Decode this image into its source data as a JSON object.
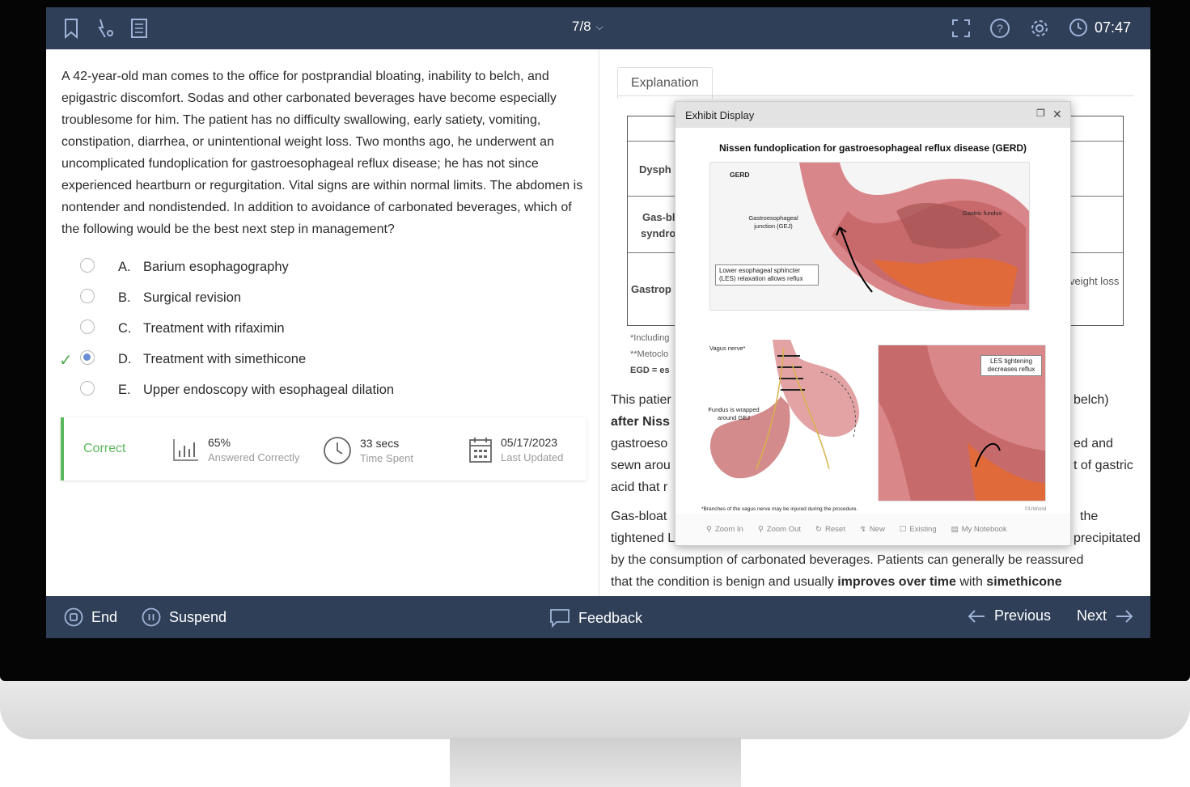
{
  "toolbar": {
    "question_counter": "7/8",
    "timer": "07:47"
  },
  "question": {
    "stem": "A 42-year-old man comes to the office for postprandial bloating, inability to belch, and epigastric discomfort.  Sodas and other carbonated beverages have become especially troublesome for him.  The patient has no difficulty swallowing, early satiety, vomiting, constipation, diarrhea, or unintentional weight loss.  Two months ago, he underwent an uncomplicated fundoplication for gastroesophageal reflux disease; he has not since experienced heartburn or regurgitation.  Vital signs are within normal limits.  The abdomen is nontender and nondistended.  In addition to avoidance of carbonated beverages, which of the following would be the best next step in management?",
    "answers": [
      {
        "letter": "A.",
        "text": "Barium esophagography",
        "selected": false,
        "correct": false
      },
      {
        "letter": "B.",
        "text": "Surgical revision",
        "selected": false,
        "correct": false
      },
      {
        "letter": "C.",
        "text": "Treatment with rifaximin",
        "selected": false,
        "correct": false
      },
      {
        "letter": "D.",
        "text": "Treatment with simethicone",
        "selected": true,
        "correct": true
      },
      {
        "letter": "E.",
        "text": "Upper endoscopy with esophageal dilation",
        "selected": false,
        "correct": false
      }
    ]
  },
  "stats": {
    "status": "Correct",
    "percent": "65%",
    "percent_label": "Answered Correctly",
    "time": "33 secs",
    "time_label": "Time Spent",
    "date": "05/17/2023",
    "date_label": "Last Updated"
  },
  "explanation": {
    "tab_label": "Explanation",
    "table_cells": [
      "Dysph",
      "Gas-bl",
      "syndro",
      "Gastrop",
      "veight loss"
    ],
    "footnotes": [
      "*Including",
      "**Metoclo",
      "EGD = es"
    ],
    "para1_lines": [
      "This patier",
      "after Niss",
      "gastroeso",
      "sewn arou",
      "acid that r"
    ],
    "para1_right": [
      "belch)",
      "ed and",
      "t of gastric"
    ],
    "para2_lines": [
      "Gas-bloat",
      "tightened L",
      "by the consumption of carbonated beverages.  Patients can generally be reassured",
      "that the condition is benign and usually"
    ],
    "para2_right": [
      "the",
      "precipitated"
    ],
    "bold_tail_1": "improves over time",
    "bold_tail_mid": "with",
    "bold_tail_2": "simethicone"
  },
  "exhibit": {
    "window_title": "Exhibit Display",
    "figure_title": "Nissen fundoplication for gastroesophageal reflux disease (GERD)",
    "labels": {
      "gerd": "GERD",
      "gej": "Gastroesophageal junction (GEJ)",
      "fundus": "Gastric fundus",
      "les": "Lower esophageal sphincter (LES) relaxation allows reflux",
      "vagus": "Vagus nerve*",
      "wrapped": "Fundus is wrapped around GEJ",
      "tightening": "LES tightening decreases reflux",
      "footnote": "*Branches of the vagus nerve may be injured during the procedure.",
      "copyright": "©UWorld"
    },
    "tools": [
      "Zoom In",
      "Zoom Out",
      "Reset",
      "New",
      "Existing",
      "My Notebook"
    ]
  },
  "bottom": {
    "end": "End",
    "suspend": "Suspend",
    "feedback": "Feedback",
    "previous": "Previous",
    "next": "Next"
  },
  "colors": {
    "bar": "#2f3f58",
    "correct": "#5cb85c",
    "radio_selected": "#6b8fd6"
  }
}
